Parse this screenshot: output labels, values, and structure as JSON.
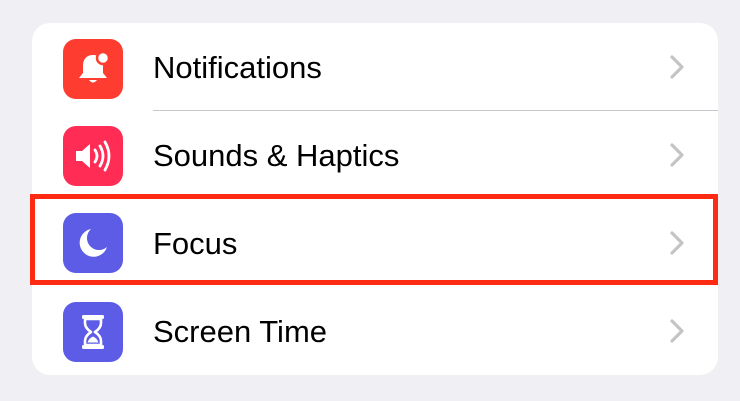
{
  "settings": {
    "items": [
      {
        "label": "Notifications",
        "icon": "bell-badge-icon",
        "color": "#fe3c30"
      },
      {
        "label": "Sounds & Haptics",
        "icon": "speaker-wave-icon",
        "color": "#ff2d55"
      },
      {
        "label": "Focus",
        "icon": "moon-icon",
        "color": "#5d5ce6"
      },
      {
        "label": "Screen Time",
        "icon": "hourglass-icon",
        "color": "#5d5ce6"
      }
    ],
    "highlighted": "Focus"
  },
  "colors": {
    "background": "#efeff4",
    "card": "#ffffff",
    "separator": "#c8c7cc",
    "chevron": "#c4c4c7",
    "highlight_border": "#ff2a12"
  }
}
